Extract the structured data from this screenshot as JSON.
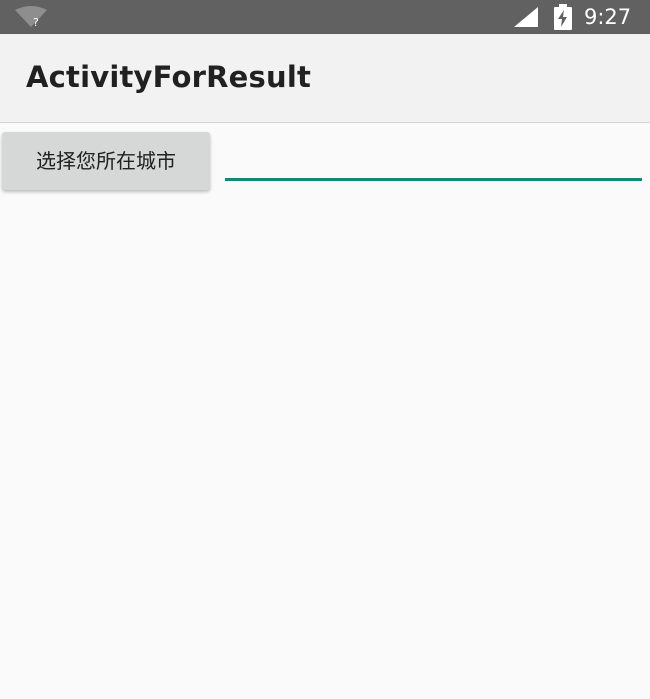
{
  "status_bar": {
    "time": "9:27",
    "wifi_icon": "wifi-unknown-icon",
    "signal_icon": "cell-signal-icon",
    "battery_icon": "battery-charging-icon",
    "background_color": "#616161"
  },
  "app_bar": {
    "title": "ActivityForResult"
  },
  "main": {
    "choose_city_button_label": "选择您所在城市",
    "city_input_value": "",
    "accent_color": "#0f8a78"
  }
}
